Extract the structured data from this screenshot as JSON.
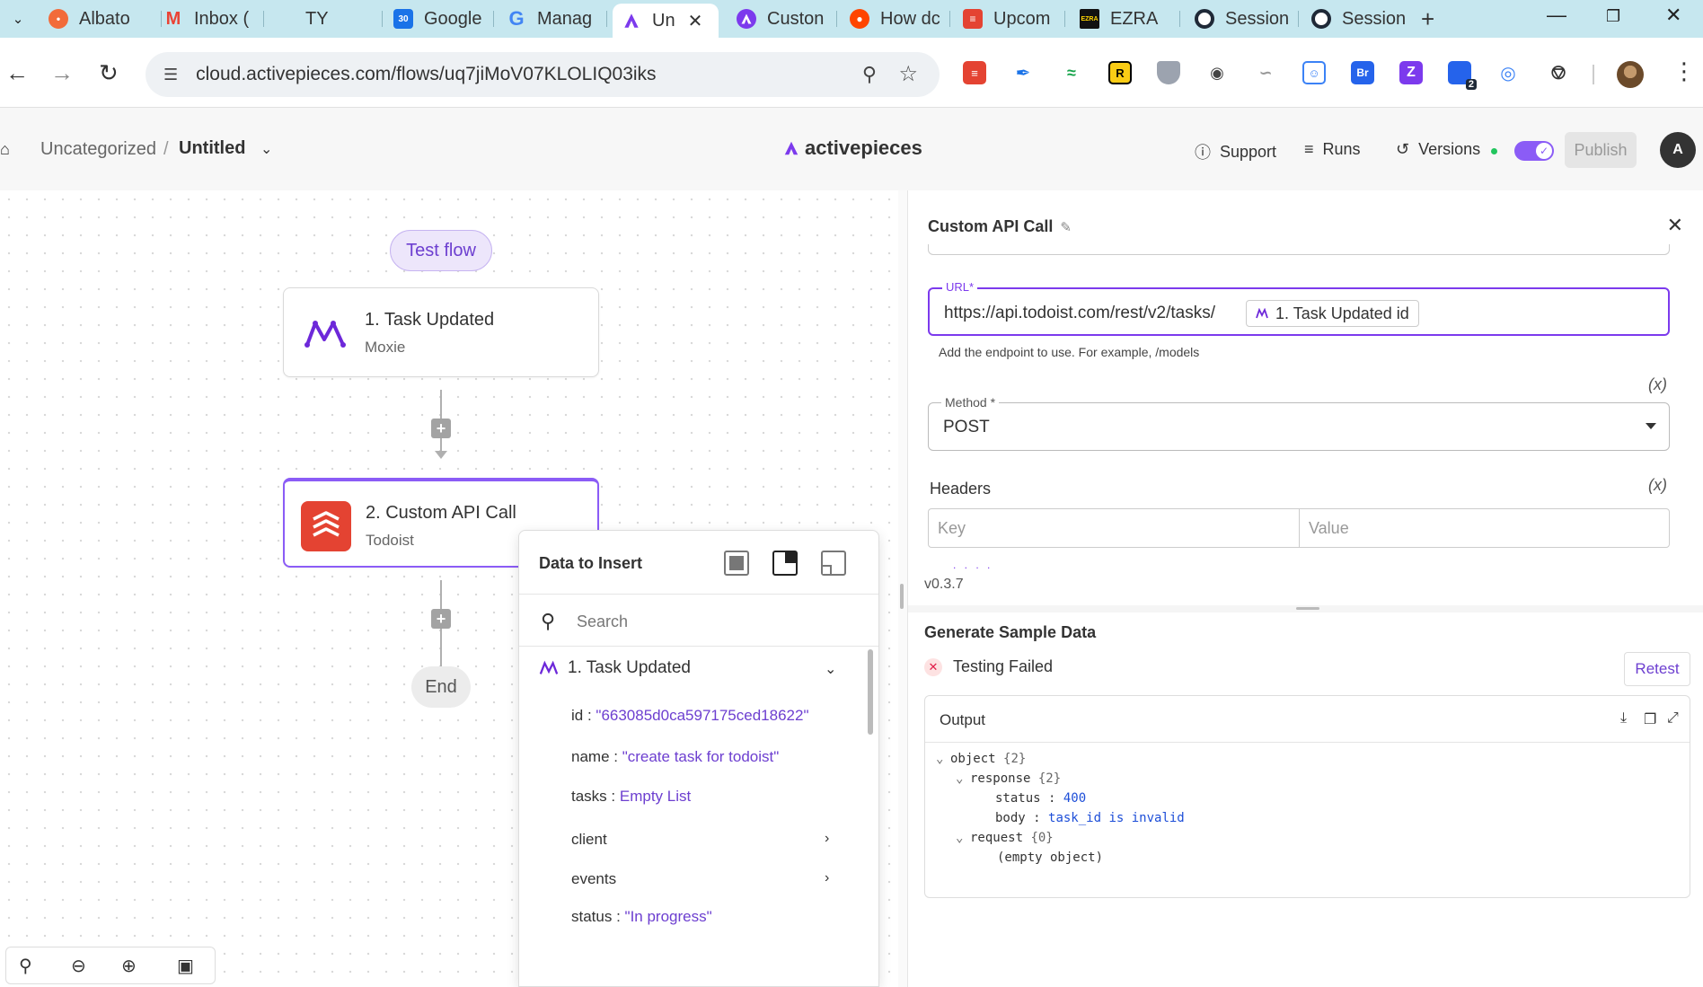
{
  "browser": {
    "tabs": [
      {
        "label": "Albato",
        "color": "#f26b3a"
      },
      {
        "label": "Inbox (",
        "color": "#ea4335"
      },
      {
        "label": "TY",
        "color": ""
      },
      {
        "label": "Google",
        "color": "#1a73e8"
      },
      {
        "label": "Manag",
        "color": "#4285f4"
      },
      {
        "label": "Un",
        "color": "#7c3aed",
        "active": true
      },
      {
        "label": "Custon",
        "color": "#7c3aed"
      },
      {
        "label": "How dc",
        "color": "#ff4500"
      },
      {
        "label": "Upcom",
        "color": "#e44332"
      },
      {
        "label": "EZRA",
        "color": "#111111"
      },
      {
        "label": "Session",
        "color": "#1f2937"
      },
      {
        "label": "Session",
        "color": "#1f2937"
      }
    ],
    "url": "cloud.activepieces.com/flows/uq7jiMoV07KLOLIQ03iks",
    "ext_badge": "2"
  },
  "header": {
    "folder": "Uncategorized",
    "separator": "/",
    "flow_name": "Untitled",
    "brand": "activepieces",
    "support": "Support",
    "runs": "Runs",
    "versions": "Versions",
    "publish": "Publish",
    "avatar": "A"
  },
  "canvas": {
    "test_flow": "Test flow",
    "steps": [
      {
        "title": "1. Task Updated",
        "subtitle": "Moxie"
      },
      {
        "title": "2. Custom API Call",
        "subtitle": "Todoist"
      }
    ],
    "end": "End"
  },
  "data_to_insert": {
    "title": "Data to Insert",
    "search_placeholder": "Search",
    "group": "1. Task Updated",
    "rows": [
      {
        "key": "id",
        "sep": " : ",
        "value": "\"663085d0ca597175ced18622\""
      },
      {
        "key": "name",
        "sep": " : ",
        "value": "\"create task for todoist\""
      },
      {
        "key": "tasks",
        "sep": " : ",
        "value": "Empty List"
      },
      {
        "key": "client",
        "sep": "",
        "value": ""
      },
      {
        "key": "events",
        "sep": "",
        "value": ""
      },
      {
        "key": "status",
        "sep": " : ",
        "value": "\"In progress\""
      }
    ]
  },
  "panel": {
    "title": "Custom API Call",
    "url_label": "URL*",
    "url_value": "https://api.todoist.com/rest/v2/tasks/",
    "url_chip": "1. Task Updated id",
    "url_hint": "Add the endpoint to use. For example, /models",
    "fx": "(x)",
    "method_label": "Method *",
    "method_value": "POST",
    "headers_label": "Headers",
    "key_placeholder": "Key",
    "value_placeholder": "Value",
    "dots": ". . . .",
    "version": "v0.3.7",
    "gen_title": "Generate Sample Data",
    "status": "Testing Failed",
    "retest": "Retest",
    "output_title": "Output",
    "tree": {
      "root": "object",
      "root_count": "{2}",
      "response": "response",
      "response_count": "{2}",
      "status_key": "status",
      "status_val": "400",
      "body_key": "body",
      "body_val": "task_id is invalid",
      "request": "request",
      "request_count": "{0}",
      "empty": "(empty object)"
    }
  },
  "colors": {
    "accent": "#7c3aed",
    "todoist": "#e44332",
    "moxie": "#6d28d9"
  }
}
